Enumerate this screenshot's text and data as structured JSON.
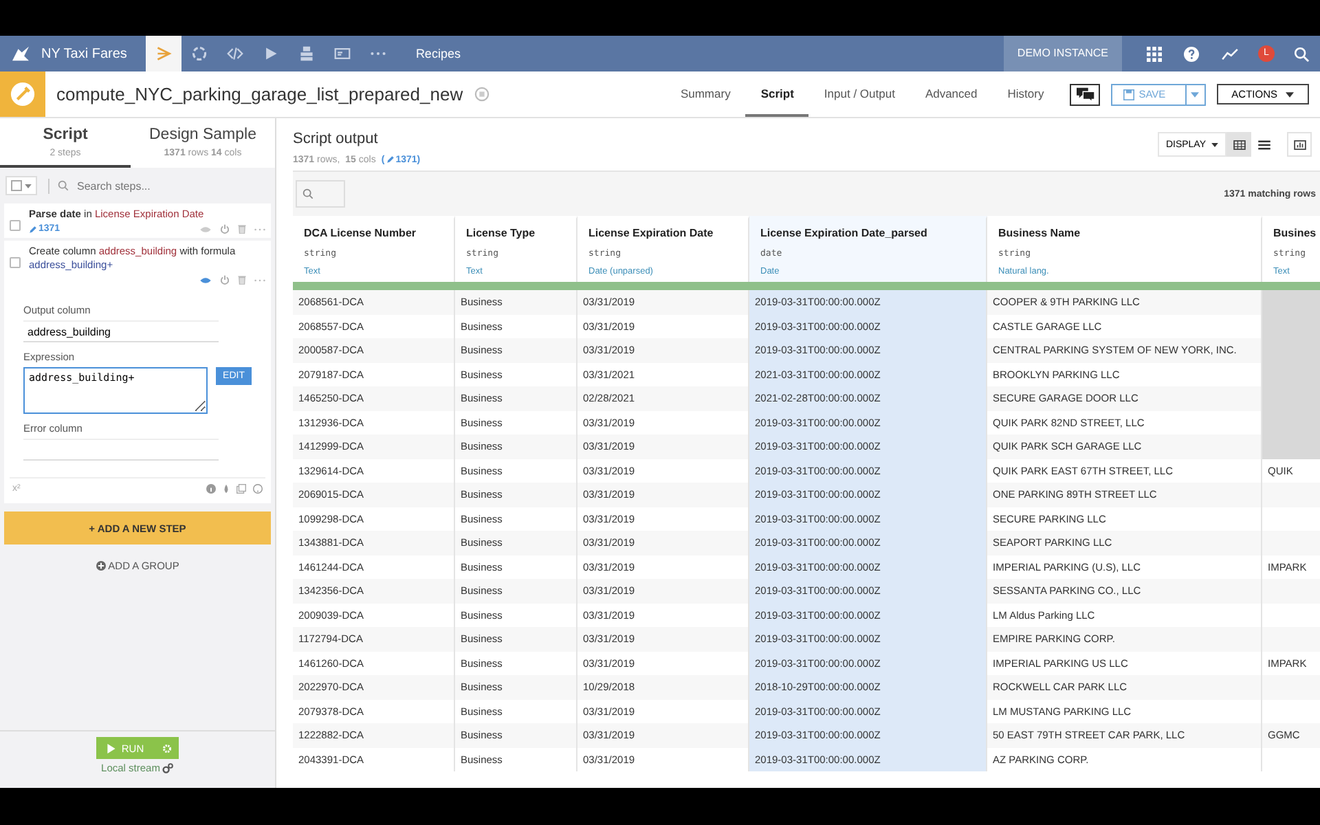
{
  "topnav": {
    "project": "NY Taxi Fares",
    "icons": [
      {
        "kind": "flow",
        "selected": true
      },
      {
        "kind": "cycle",
        "selected": false
      },
      {
        "kind": "code",
        "selected": false
      },
      {
        "kind": "play",
        "selected": false
      },
      {
        "kind": "stack",
        "selected": false
      },
      {
        "kind": "card",
        "selected": false
      },
      {
        "kind": "dots",
        "selected": false
      }
    ],
    "section": "Recipes",
    "instance": "DEMO INSTANCE",
    "avatar": "L"
  },
  "header": {
    "title": "compute_NYC_parking_garage_list_prepared_new",
    "tabs": [
      {
        "label": "Summary",
        "selected": false
      },
      {
        "label": "Script",
        "selected": true
      },
      {
        "label": "Input / Output",
        "selected": false
      },
      {
        "label": "Advanced",
        "selected": false
      },
      {
        "label": "History",
        "selected": false
      }
    ],
    "save": "SAVE",
    "actions": "ACTIONS"
  },
  "left": {
    "tabs": [
      {
        "label": "Script",
        "sub": "2 steps",
        "selected": true
      },
      {
        "label": "Design Sample",
        "sub": "**1371** rows **14** cols",
        "selected": false
      }
    ],
    "search": {
      "placeholder": "Search steps..."
    },
    "steps": [
      {
        "parts": [
          "**Parse date** in",
          "License Expiration Date"
        ],
        "count": "1371",
        "checked": false,
        "expanded": false
      },
      {
        "parts": [
          "Create column",
          "address_building",
          "with formula",
          "address_building+"
        ],
        "checked": false,
        "expanded": true,
        "output_label": "Output column",
        "output": "address_building",
        "expr_label": "Expression",
        "expr": "address_building+",
        "edit": "EDIT",
        "error_label": "Error column",
        "footer": "x²"
      }
    ],
    "add_step": "+ ADD A NEW STEP",
    "add_group": "ADD A GROUP",
    "run": "RUN",
    "engine": "Local stream"
  },
  "output": {
    "title": "Script output",
    "dims": "**1371** rows,  **15** cols",
    "count_open": "(",
    "count": "1371",
    "count_close": ")",
    "display": "DISPLAY",
    "views": [
      {
        "kind": "table",
        "selected": true
      },
      {
        "kind": "list",
        "selected": false
      }
    ],
    "matching": "1371 matching rows",
    "columns": [
      {
        "name": "DCA License Number",
        "type": "string",
        "meaning": "Text",
        "selected": false
      },
      {
        "name": "License Type",
        "type": "string",
        "meaning": "Text",
        "selected": false
      },
      {
        "name": "License Expiration Date",
        "type": "string",
        "meaning": "Date (unparsed)",
        "selected": false
      },
      {
        "name": "License Expiration Date_parsed",
        "type": "date",
        "meaning": "Date",
        "selected": true
      },
      {
        "name": "Business Name",
        "type": "string",
        "meaning": "Natural lang.",
        "selected": false
      },
      {
        "name": "Busines",
        "type": "string",
        "meaning": "Text",
        "selected": false
      }
    ],
    "rows_data": [
      {
        "cells": [
          "2068561-DCA",
          "Business",
          "03/31/2019",
          "2019-03-31T00:00:00.000Z",
          "COOPER & 9TH PARKING LLC"
        ],
        "missing": true
      },
      {
        "cells": [
          "2068557-DCA",
          "Business",
          "03/31/2019",
          "2019-03-31T00:00:00.000Z",
          "CASTLE GARAGE LLC"
        ],
        "missing": true
      },
      {
        "cells": [
          "2000587-DCA",
          "Business",
          "03/31/2019",
          "2019-03-31T00:00:00.000Z",
          "CENTRAL PARKING SYSTEM OF NEW YORK, INC."
        ],
        "missing": true
      },
      {
        "cells": [
          "2079187-DCA",
          "Business",
          "03/31/2021",
          "2021-03-31T00:00:00.000Z",
          "BROOKLYN PARKING LLC"
        ],
        "missing": true
      },
      {
        "cells": [
          "1465250-DCA",
          "Business",
          "02/28/2021",
          "2021-02-28T00:00:00.000Z",
          "SECURE GARAGE DOOR LLC"
        ],
        "missing": true
      },
      {
        "cells": [
          "1312936-DCA",
          "Business",
          "03/31/2019",
          "2019-03-31T00:00:00.000Z",
          "QUIK PARK 82ND STREET, LLC"
        ],
        "missing": true
      },
      {
        "cells": [
          "1412999-DCA",
          "Business",
          "03/31/2019",
          "2019-03-31T00:00:00.000Z",
          "QUIK PARK SCH GARAGE LLC"
        ],
        "missing": true
      },
      {
        "cells": [
          "1329614-DCA",
          "Business",
          "03/31/2019",
          "2019-03-31T00:00:00.000Z",
          "QUIK PARK EAST 67TH STREET, LLC",
          "QUIK"
        ]
      },
      {
        "cells": [
          "2069015-DCA",
          "Business",
          "03/31/2019",
          "2019-03-31T00:00:00.000Z",
          "ONE PARKING 89TH STREET LLC"
        ]
      },
      {
        "cells": [
          "1099298-DCA",
          "Business",
          "03/31/2019",
          "2019-03-31T00:00:00.000Z",
          "SECURE PARKING LLC"
        ]
      },
      {
        "cells": [
          "1343881-DCA",
          "Business",
          "03/31/2019",
          "2019-03-31T00:00:00.000Z",
          "SEAPORT PARKING LLC"
        ]
      },
      {
        "cells": [
          "1461244-DCA",
          "Business",
          "03/31/2019",
          "2019-03-31T00:00:00.000Z",
          "IMPERIAL PARKING (U.S), LLC",
          "IMPARK"
        ]
      },
      {
        "cells": [
          "1342356-DCA",
          "Business",
          "03/31/2019",
          "2019-03-31T00:00:00.000Z",
          "SESSANTA PARKING CO., LLC"
        ]
      },
      {
        "cells": [
          "2009039-DCA",
          "Business",
          "03/31/2019",
          "2019-03-31T00:00:00.000Z",
          "LM Aldus Parking LLC"
        ]
      },
      {
        "cells": [
          "1172794-DCA",
          "Business",
          "03/31/2019",
          "2019-03-31T00:00:00.000Z",
          "EMPIRE PARKING CORP."
        ]
      },
      {
        "cells": [
          "1461260-DCA",
          "Business",
          "03/31/2019",
          "2019-03-31T00:00:00.000Z",
          "IMPERIAL PARKING US LLC",
          "IMPARK"
        ]
      },
      {
        "cells": [
          "2022970-DCA",
          "Business",
          "10/29/2018",
          "2018-10-29T00:00:00.000Z",
          "ROCKWELL CAR PARK LLC"
        ]
      },
      {
        "cells": [
          "2079378-DCA",
          "Business",
          "03/31/2019",
          "2019-03-31T00:00:00.000Z",
          "LM MUSTANG PARKING LLC"
        ]
      },
      {
        "cells": [
          "1222882-DCA",
          "Business",
          "03/31/2019",
          "2019-03-31T00:00:00.000Z",
          "50 EAST 79TH STREET CAR PARK, LLC",
          "GGMC"
        ]
      },
      {
        "cells": [
          "2043391-DCA",
          "Business",
          "03/31/2019",
          "2019-03-31T00:00:00.000Z",
          "AZ PARKING CORP."
        ]
      }
    ]
  }
}
